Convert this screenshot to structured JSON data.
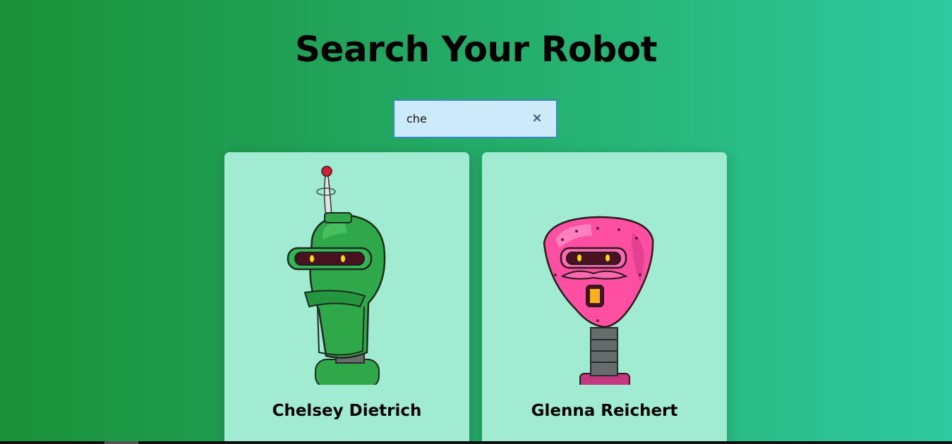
{
  "page": {
    "title": "Search Your Robot"
  },
  "search": {
    "value": "che",
    "placeholder": "",
    "clear_icon": "×"
  },
  "robots": [
    {
      "name": "Chelsey Dietrich",
      "image": "green-robot-avatar",
      "color": "#2fa84a"
    },
    {
      "name": "Glenna Reichert",
      "image": "pink-robot-avatar",
      "color": "#ff4fa3"
    }
  ],
  "colors": {
    "background_start": "#1a9138",
    "background_end": "#2ec9a0",
    "card_bg": "#a1ebd2",
    "search_bg": "#cdeafb",
    "search_border": "#3f86c4"
  }
}
